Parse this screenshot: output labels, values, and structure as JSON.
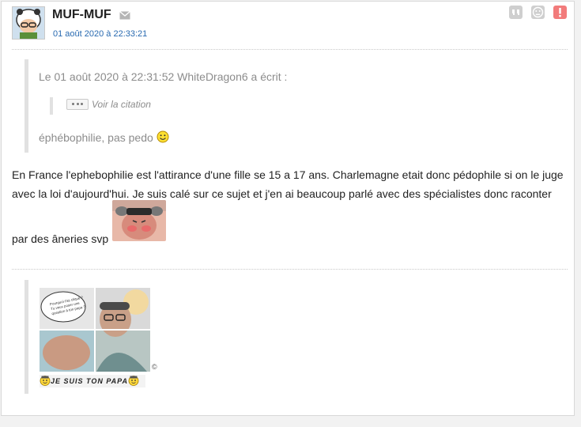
{
  "post": {
    "author": "MUF-MUF",
    "date": "01 août 2020 à 22:33:21",
    "icons": [
      "envelope-icon",
      "quote-icon",
      "sad-face-icon",
      "report-icon"
    ]
  },
  "quote": {
    "header": "Le 01 août 2020 à 22:31:52 WhiteDragon6 a écrit :",
    "nested_quote_label": "Voir la citation",
    "text": "éphébophilie, pas pedo"
  },
  "message": {
    "text_line1": "En France l'ephebophilie est l'attirance d'une fille se 15 a 17 ans. Charlemagne etait donc pédophile si on le juge avec la loi d'aujourd'hui. Je suis calé sur ce sujet et j'en ai beaucoup parlé avec des spécialistes donc raconter",
    "text_line2": "par des âneries svp"
  },
  "signature": {
    "speech_bubble": "Pourquoi t'as cliqué ? Tu veux poser une question à ton papa ?",
    "caption": "JE SUIS TON PAPA",
    "copyright": "©"
  },
  "colors": {
    "link": "#2769b0",
    "quote_border": "#e1e1e1",
    "icon_gray": "#cfcfcf",
    "report": "#f27b7b"
  }
}
